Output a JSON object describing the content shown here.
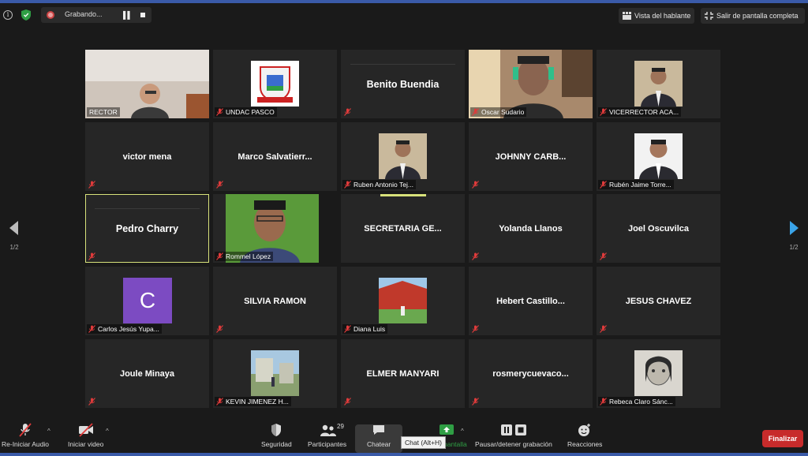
{
  "topbar": {
    "recording_label": "Grabando...",
    "speaker_view_label": "Vista del hablante",
    "exit_fullscreen_label": "Salir de pantalla completa"
  },
  "pagination": {
    "left": "1/2",
    "right": "1/2"
  },
  "tiles": [
    {
      "name": "RECTOR",
      "muted": false
    },
    {
      "name": "UNDAC PASCO",
      "muted": true
    },
    {
      "name": "Benito Buendia",
      "muted": true
    },
    {
      "name": "Oscar Sudario",
      "muted": true
    },
    {
      "name": "VICERRECTOR ACA...",
      "muted": true
    },
    {
      "name": "victor mena",
      "muted": true
    },
    {
      "name": "Marco  Salvatierr...",
      "muted": true
    },
    {
      "name": "Ruben Antonio Tej...",
      "muted": true
    },
    {
      "name": "JOHNNY  CARB...",
      "muted": true
    },
    {
      "name": "Rubén Jaime Torre...",
      "muted": true
    },
    {
      "name": "Pedro Charry",
      "muted": true
    },
    {
      "name": "Rommel López",
      "muted": true
    },
    {
      "name": "SECRETARIA  GE...",
      "muted": false
    },
    {
      "name": "Yolanda Llanos",
      "muted": true
    },
    {
      "name": "Joel Oscuvilca",
      "muted": true
    },
    {
      "name": "Carlos Jesús Yupa...",
      "muted": true,
      "avatar_letter": "C"
    },
    {
      "name": "SILVIA RAMON",
      "muted": true
    },
    {
      "name": "Diana Luis",
      "muted": true
    },
    {
      "name": "Hebert  Castillo...",
      "muted": true
    },
    {
      "name": "JESUS CHAVEZ",
      "muted": true
    },
    {
      "name": "Joule Minaya",
      "muted": true
    },
    {
      "name": "KEVIN JIMENEZ H...",
      "muted": true
    },
    {
      "name": "ELMER MANYARI",
      "muted": true
    },
    {
      "name": "rosmerycuevaco...",
      "muted": true
    },
    {
      "name": "Rebeca Claro Sánc...",
      "muted": true
    }
  ],
  "toolbar": {
    "reunmute_label": "Re-Iniciar Audio",
    "start_video_label": "Iniciar video",
    "security_label": "Seguridad",
    "participants_label": "Participantes",
    "participants_count": "29",
    "chat_label": "Chatear",
    "share_label": "pantalla",
    "record_label": "Pausar/detener grabación",
    "reactions_label": "Reacciones",
    "end_label": "Finalizar",
    "chat_tooltip": "Chat (Alt+H)"
  },
  "colors": {
    "accent_active": "#d8e27b",
    "end_button": "#c72b2b",
    "share_green": "#2f9e44",
    "avatar_purple": "#7c4bc2"
  }
}
